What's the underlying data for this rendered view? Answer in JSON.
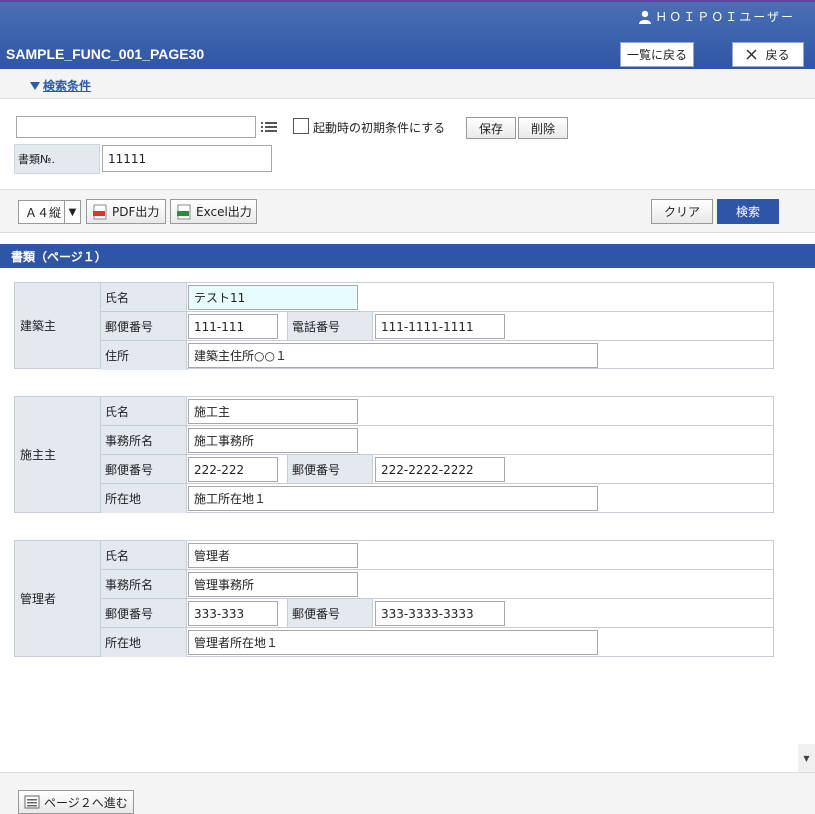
{
  "header": {
    "user_name": "ＨＯＩＰＯＩユーザー",
    "page_title": "SAMPLE_FUNC_001_PAGE30",
    "list_back_label": "一覧に戻る",
    "back_label": "戻る"
  },
  "search": {
    "toggle_label": "検索条件",
    "condition_value": "",
    "initial_checkbox_label": "起動時の初期条件にする",
    "save_label": "保存",
    "delete_label": "削除",
    "docno_label": "書類№.",
    "docno_value": "11111"
  },
  "toolbar": {
    "paper_size": "Ａ４縦",
    "pdf_label": "PDF出力",
    "excel_label": "Excel出力",
    "clear_label": "クリア",
    "search_label": "検索"
  },
  "section": {
    "title": "書類（ページ１）"
  },
  "owner": {
    "group_label": "建築主",
    "name_label": "氏名",
    "name_value": "テスト11",
    "postal_label": "郵便番号",
    "postal_value": "111-111",
    "phone_label": "電話番号",
    "phone_value": "111-1111-1111",
    "address_label": "住所",
    "address_value": "建築主住所○○１"
  },
  "contractor": {
    "group_label": "施主主",
    "name_label": "氏名",
    "name_value": "施工主",
    "office_label": "事務所名",
    "office_value": "施工事務所",
    "postal_label": "郵便番号",
    "postal_value": "222-222",
    "postal2_label": "郵便番号",
    "postal2_value": "222-2222-2222",
    "location_label": "所在地",
    "location_value": "施工所在地１"
  },
  "manager": {
    "group_label": "管理者",
    "name_label": "氏名",
    "name_value": "管理者",
    "office_label": "事務所名",
    "office_value": "管理事務所",
    "postal_label": "郵便番号",
    "postal_value": "333-333",
    "postal2_label": "郵便番号",
    "postal2_value": "333-3333-3333",
    "location_label": "所在地",
    "location_value": "管理者所在地１"
  },
  "footer": {
    "next_page_label": "ページ２へ進む"
  }
}
